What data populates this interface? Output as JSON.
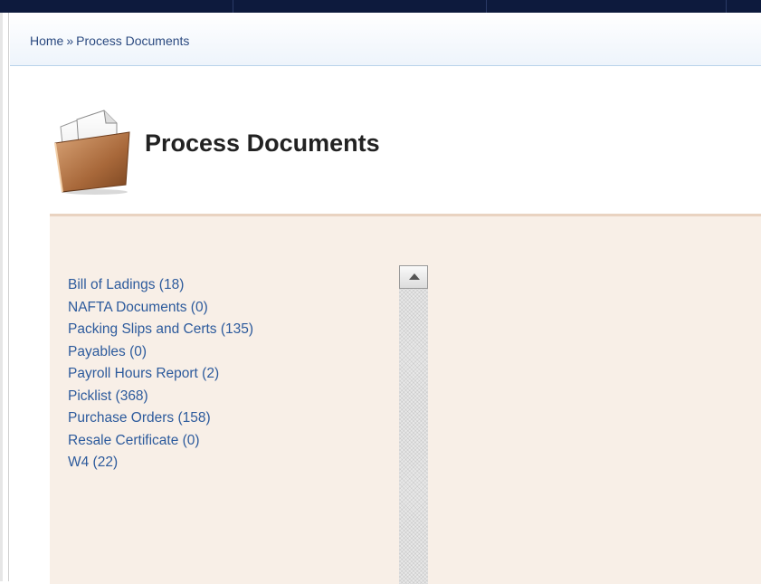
{
  "breadcrumb": {
    "home_label": "Home",
    "separator": "»",
    "current_label": "Process Documents"
  },
  "page": {
    "title": "Process Documents",
    "icon": "documents-folder-icon"
  },
  "document_types": [
    {
      "label": "Bill of Ladings (18)"
    },
    {
      "label": "NAFTA Documents (0)"
    },
    {
      "label": "Packing Slips and Certs (135)"
    },
    {
      "label": "Payables (0)"
    },
    {
      "label": "Payroll Hours Report (2)"
    },
    {
      "label": "Picklist (368)"
    },
    {
      "label": "Purchase Orders (158)"
    },
    {
      "label": "Resale Certificate (0)"
    },
    {
      "label": "W4 (22)"
    }
  ],
  "colors": {
    "top_bar": "#0d1a3d",
    "link": "#2c5a9c",
    "panel_bg": "#f8efe7",
    "breadcrumb_text": "#2b4a80"
  }
}
